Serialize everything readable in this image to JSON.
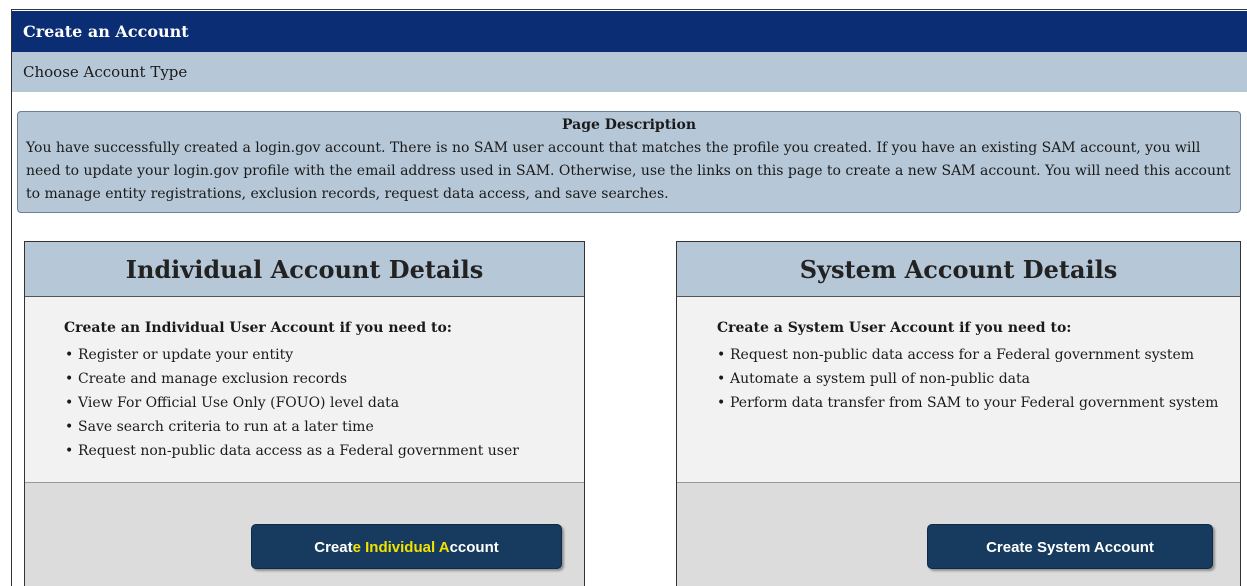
{
  "header": {
    "title": "Create an Account"
  },
  "subheader": {
    "title": "Choose Account Type"
  },
  "description": {
    "title": "Page Description",
    "text": "You have successfully created a login.gov account. There is no SAM user account that matches the profile you created. If you have an existing SAM account, you will need to update your login.gov profile with the email address used in SAM. Otherwise, use the links on this page to create a new SAM account. You will need this account to manage entity registrations, exclusion records, request data access, and save searches."
  },
  "individual_card": {
    "title": "Individual Account Details",
    "intro": "Create an Individual User Account if you need to:",
    "items": [
      "Register or update your entity",
      "Create and manage exclusion records",
      "View For Official Use Only (FOUO) level data",
      "Save search criteria to run at a later time",
      "Request non-public data access as a Federal government user"
    ],
    "button": {
      "part1": "Creat",
      "part2": "e Individual A",
      "part3": "ccount"
    }
  },
  "system_card": {
    "title": "System Account Details",
    "intro": "Create a System User Account if you need to:",
    "items": [
      "Request non-public data access for a Federal government system",
      "Automate a system pull of non-public data",
      "Perform data transfer from SAM to your Federal government system"
    ],
    "button": {
      "label": "Create System Account"
    }
  },
  "colors": {
    "header_bg": "#0b2d73",
    "panel_bg": "#b6c7d7",
    "button_bg": "#163b5f",
    "highlight_text": "#f2e200"
  }
}
